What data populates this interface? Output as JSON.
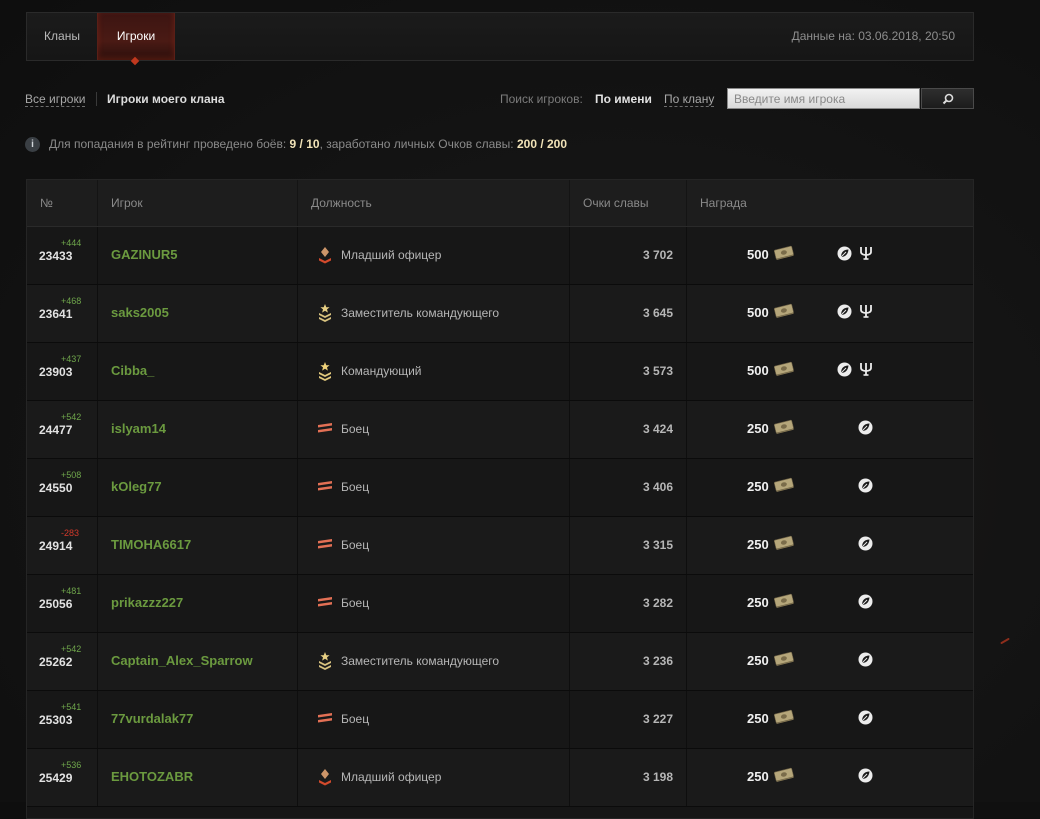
{
  "tabs": [
    {
      "label": "Кланы",
      "active": false
    },
    {
      "label": "Игроки",
      "active": true
    }
  ],
  "data_date": "Данные на: 03.06.2018, 20:50",
  "filters": {
    "all_players": "Все игроки",
    "my_clan_players": "Игроки моего клана",
    "search_label": "Поиск игроков:",
    "by_name": "По имени",
    "by_clan": "По клану",
    "search_placeholder": "Введите имя игрока"
  },
  "info": {
    "text_before": "Для попадания в рейтинг проведено боёв:",
    "battles": "9 / 10",
    "text_middle": ", заработано личных Очков славы:",
    "points": "200 / 200"
  },
  "columns": {
    "num": "№",
    "player": "Игрок",
    "role": "Должность",
    "fame": "Очки славы",
    "reward": "Награда"
  },
  "colors": {
    "accent_red": "#c0381e",
    "player_green": "#6b9a3f",
    "delta_positive": "#6fa64b",
    "delta_negative": "#d0392b",
    "highlight_yellow": "#f1e3b8"
  },
  "rows": [
    {
      "rank": "23433",
      "delta": "+444",
      "name": "GAZINUR5",
      "role": "Младший офицер",
      "role_icon": "junior-officer-icon",
      "fame": "3 702",
      "reward": "500",
      "style_reward": true
    },
    {
      "rank": "23641",
      "delta": "+468",
      "name": "saks2005",
      "role": "Заместитель командующего",
      "role_icon": "deputy-commander-icon",
      "fame": "3 645",
      "reward": "500",
      "style_reward": true
    },
    {
      "rank": "23903",
      "delta": "+437",
      "name": "Cibba_",
      "role": "Командующий",
      "role_icon": "commander-icon",
      "fame": "3 573",
      "reward": "500",
      "style_reward": true
    },
    {
      "rank": "24477",
      "delta": "+542",
      "name": "islyam14",
      "role": "Боец",
      "role_icon": "private-icon",
      "fame": "3 424",
      "reward": "250",
      "style_reward": false
    },
    {
      "rank": "24550",
      "delta": "+508",
      "name": "kOleg77",
      "role": "Боец",
      "role_icon": "private-icon",
      "fame": "3 406",
      "reward": "250",
      "style_reward": false
    },
    {
      "rank": "24914",
      "delta": "-283",
      "name": "TIMOHA6617",
      "role": "Боец",
      "role_icon": "private-icon",
      "fame": "3 315",
      "reward": "250",
      "style_reward": false
    },
    {
      "rank": "25056",
      "delta": "+481",
      "name": "prikazzz227",
      "role": "Боец",
      "role_icon": "private-icon",
      "fame": "3 282",
      "reward": "250",
      "style_reward": false
    },
    {
      "rank": "25262",
      "delta": "+542",
      "name": "Captain_Alex_Sparrow",
      "role": "Заместитель командующего",
      "role_icon": "deputy-commander-icon",
      "fame": "3 236",
      "reward": "250",
      "style_reward": false
    },
    {
      "rank": "25303",
      "delta": "+541",
      "name": "77vurdalak77",
      "role": "Боец",
      "role_icon": "private-icon",
      "fame": "3 227",
      "reward": "250",
      "style_reward": false
    },
    {
      "rank": "25429",
      "delta": "+536",
      "name": "EHOTOZABR",
      "role": "Младший офицер",
      "role_icon": "junior-officer-icon",
      "fame": "3 198",
      "reward": "250",
      "style_reward": false
    }
  ]
}
